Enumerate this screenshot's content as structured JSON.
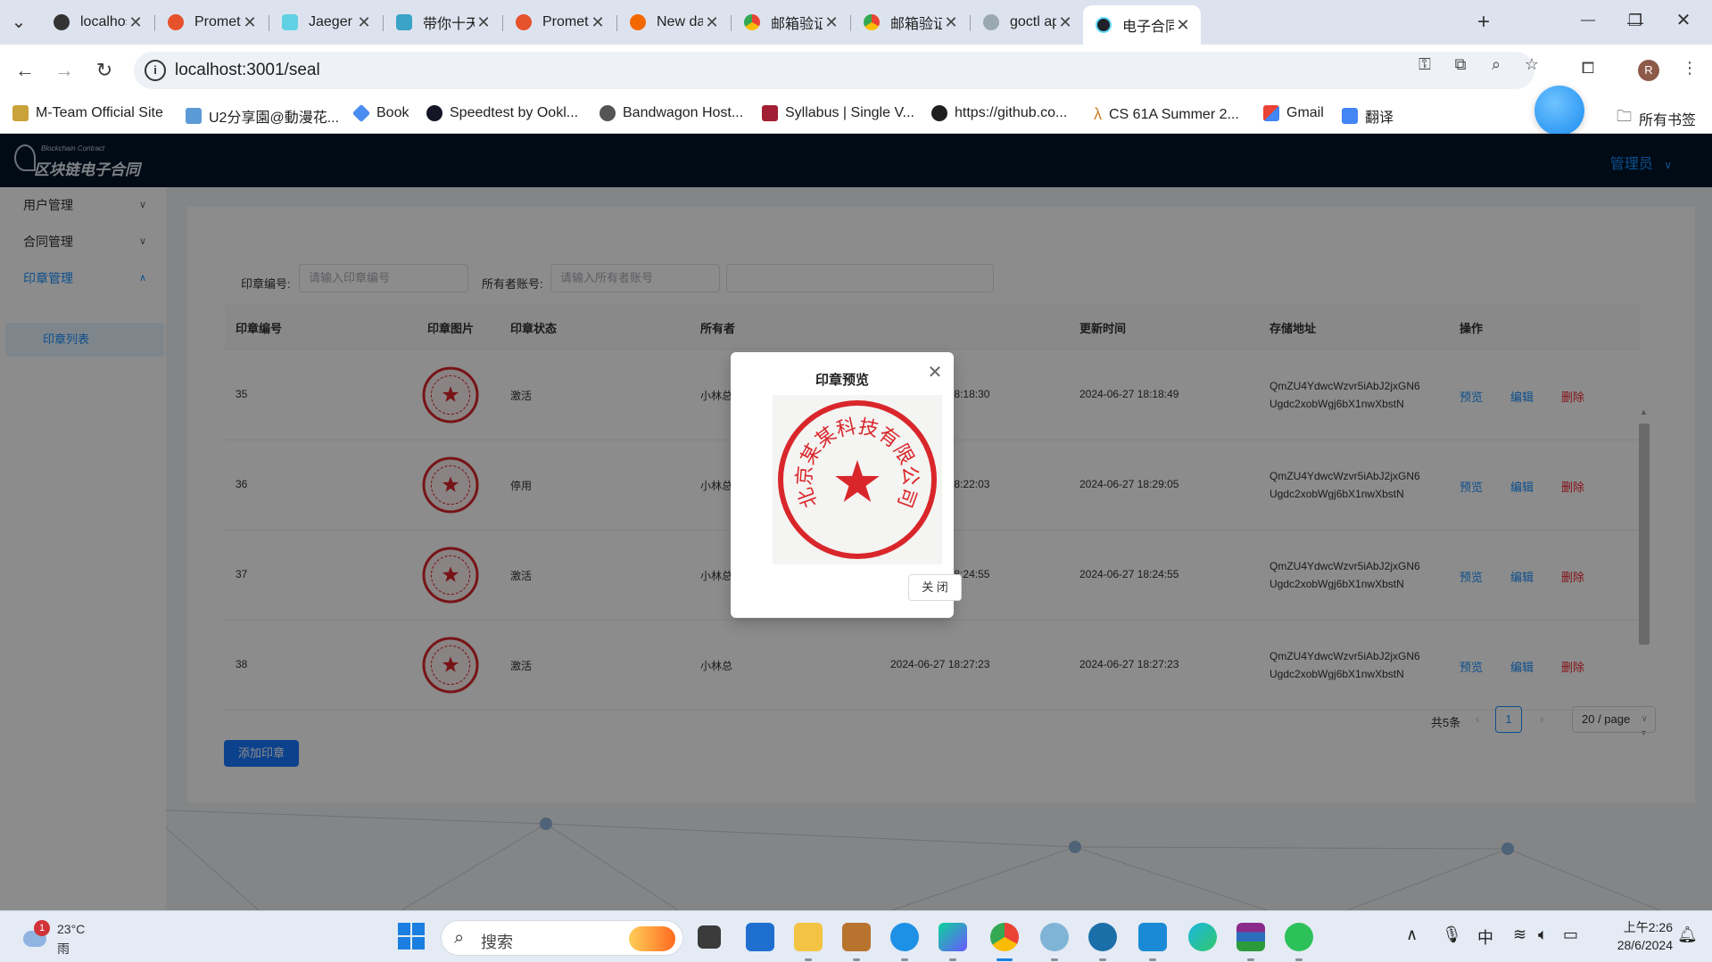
{
  "browser": {
    "tabs": [
      {
        "label": "localhost",
        "active": false
      },
      {
        "label": "Promethe",
        "active": false
      },
      {
        "label": "Jaeger UI",
        "active": false
      },
      {
        "label": "带你十天轻",
        "active": false
      },
      {
        "label": "Promethe",
        "active": false
      },
      {
        "label": "New dash",
        "active": false
      },
      {
        "label": "邮箱验证码",
        "active": false
      },
      {
        "label": "邮箱验证码",
        "active": false
      },
      {
        "label": "goctl api",
        "active": false
      },
      {
        "label": "电子合同系",
        "active": true
      }
    ],
    "url": "localhost:3001/seal",
    "profile_initial": "R",
    "bookmarks": [
      "M-Team Official Site",
      "U2分享園@動漫花...",
      "Book",
      "Speedtest by Ookl...",
      "Bandwagon Host...",
      "Syllabus | Single V...",
      "https://github.co...",
      "CS 61A Summer 2...",
      "Gmail",
      "翻译"
    ],
    "all_bookmarks": "所有书签"
  },
  "app": {
    "logo_text": "区块链电子合同",
    "logo_sub": "Blockchain Contract",
    "admin_label": "管理员",
    "sidebar": {
      "items": [
        {
          "label": "用户管理"
        },
        {
          "label": "合同管理"
        },
        {
          "label": "印章管理"
        }
      ],
      "sub_item": "印章列表"
    },
    "filters": {
      "seal_no_label": "印章编号:",
      "seal_no_placeholder": "请输入印章编号",
      "owner_label": "所有者账号:",
      "owner_placeholder": "请输入所有者账号"
    },
    "table": {
      "headers": [
        "印章编号",
        "印章图片",
        "印章状态",
        "所有者",
        "",
        "更新时间",
        "存储地址",
        "操作"
      ],
      "rows": [
        {
          "id": "35",
          "status": "激活",
          "owner": "小林总",
          "created": "2024-06-27 18:18:30",
          "updated": "2024-06-27 18:18:49",
          "addr1": "QmZU4YdwcWzvr5iAbJ2jxGN6",
          "addr2": "Ugdc2xobWgj6bX1nwXbstN"
        },
        {
          "id": "36",
          "status": "停用",
          "owner": "小林总",
          "created": "2024-06-27 18:22:03",
          "updated": "2024-06-27 18:29:05",
          "addr1": "QmZU4YdwcWzvr5iAbJ2jxGN6",
          "addr2": "Ugdc2xobWgj6bX1nwXbstN"
        },
        {
          "id": "37",
          "status": "激活",
          "owner": "小林总",
          "created": "2024-06-27 18:24:55",
          "updated": "2024-06-27 18:24:55",
          "addr1": "QmZU4YdwcWzvr5iAbJ2jxGN6",
          "addr2": "Ugdc2xobWgj6bX1nwXbstN"
        },
        {
          "id": "38",
          "status": "激活",
          "owner": "小林总",
          "created": "2024-06-27 18:27:23",
          "updated": "2024-06-27 18:27:23",
          "addr1": "QmZU4YdwcWzvr5iAbJ2jxGN6",
          "addr2": "Ugdc2xobWgj6bX1nwXbstN"
        }
      ],
      "actions": {
        "preview": "预览",
        "edit": "编辑",
        "delete": "删除"
      }
    },
    "pagination": {
      "total": "共5条",
      "current_page": "1",
      "page_size": "20 / page"
    },
    "add_button": "添加印章",
    "modal": {
      "title": "印章预览",
      "close_button": "关 闭",
      "seal_text": "北京某某科技有限公司"
    }
  },
  "taskbar": {
    "weather_temp": "23°C",
    "weather_desc": "雨",
    "weather_badge": "1",
    "search_label": "搜索",
    "ime": "中",
    "time": "上午2:26",
    "date": "28/6/2024"
  },
  "colors": {
    "primary": "#1890ff",
    "danger": "#f5222d",
    "header_bg": "#001529",
    "seal_red": "#d9262b"
  }
}
